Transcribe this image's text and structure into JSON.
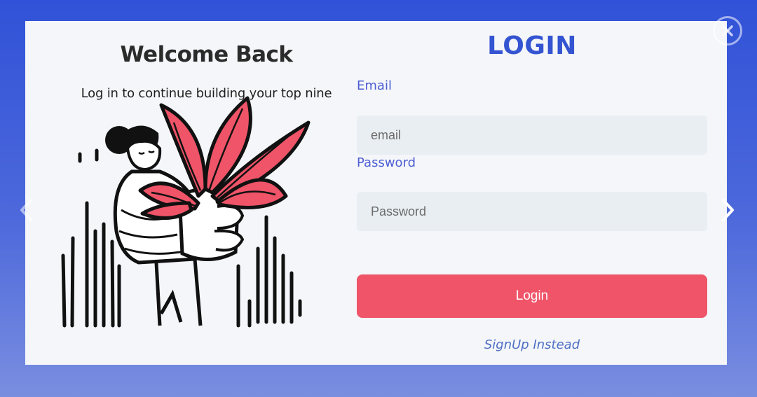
{
  "left_panel": {
    "title": "Welcome Back",
    "subtitle": "Log in to continue building your top nine",
    "illustration_icon": "person-holding-plant-illustration"
  },
  "form": {
    "title": "LOGIN",
    "email_label": "Email",
    "email_placeholder": "email",
    "email_value": "",
    "password_label": "Password",
    "password_placeholder": "Password",
    "password_value": "",
    "login_button_label": "Login",
    "signup_link_label": "SignUp Instead"
  },
  "controls": {
    "close_icon": "close-icon",
    "prev_icon": "chevron-left-icon",
    "next_icon": "chevron-right-icon"
  },
  "colors": {
    "backdrop_top": "#3152d8",
    "backdrop_bottom": "#7a8ee0",
    "modal_bg": "#f4f6f9",
    "accent_blue": "#3454d1",
    "label_blue": "#4d5ed4",
    "button_red": "#ef5468",
    "plant_red": "#ef5468",
    "input_bg": "#e9eef2"
  }
}
